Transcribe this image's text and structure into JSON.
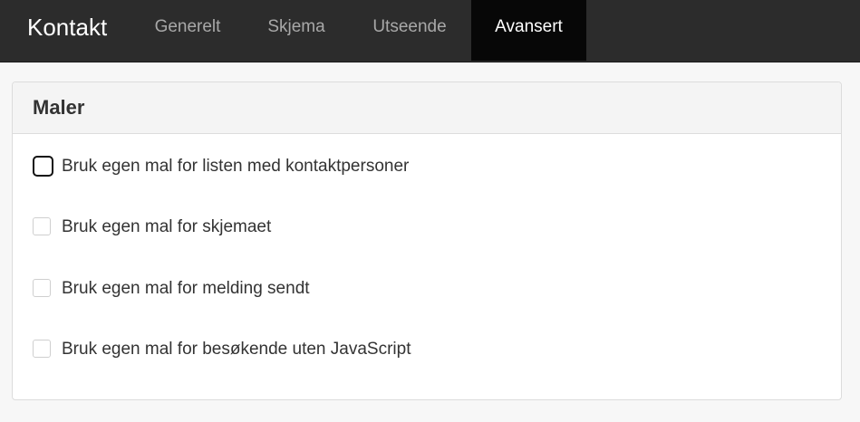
{
  "header": {
    "brand": "Kontakt",
    "tabs": [
      {
        "label": "Generelt"
      },
      {
        "label": "Skjema"
      },
      {
        "label": "Utseende"
      },
      {
        "label": "Avansert"
      }
    ],
    "active_tab": "Avansert"
  },
  "panel": {
    "title": "Maler",
    "options": [
      {
        "label": "Bruk egen mal for listen med kontaktpersoner",
        "checked": false,
        "focused": true
      },
      {
        "label": "Bruk egen mal for skjemaet",
        "checked": false
      },
      {
        "label": "Bruk egen mal for melding sendt",
        "checked": false
      },
      {
        "label": "Bruk egen mal for besøkende uten JavaScript",
        "checked": false
      }
    ]
  }
}
